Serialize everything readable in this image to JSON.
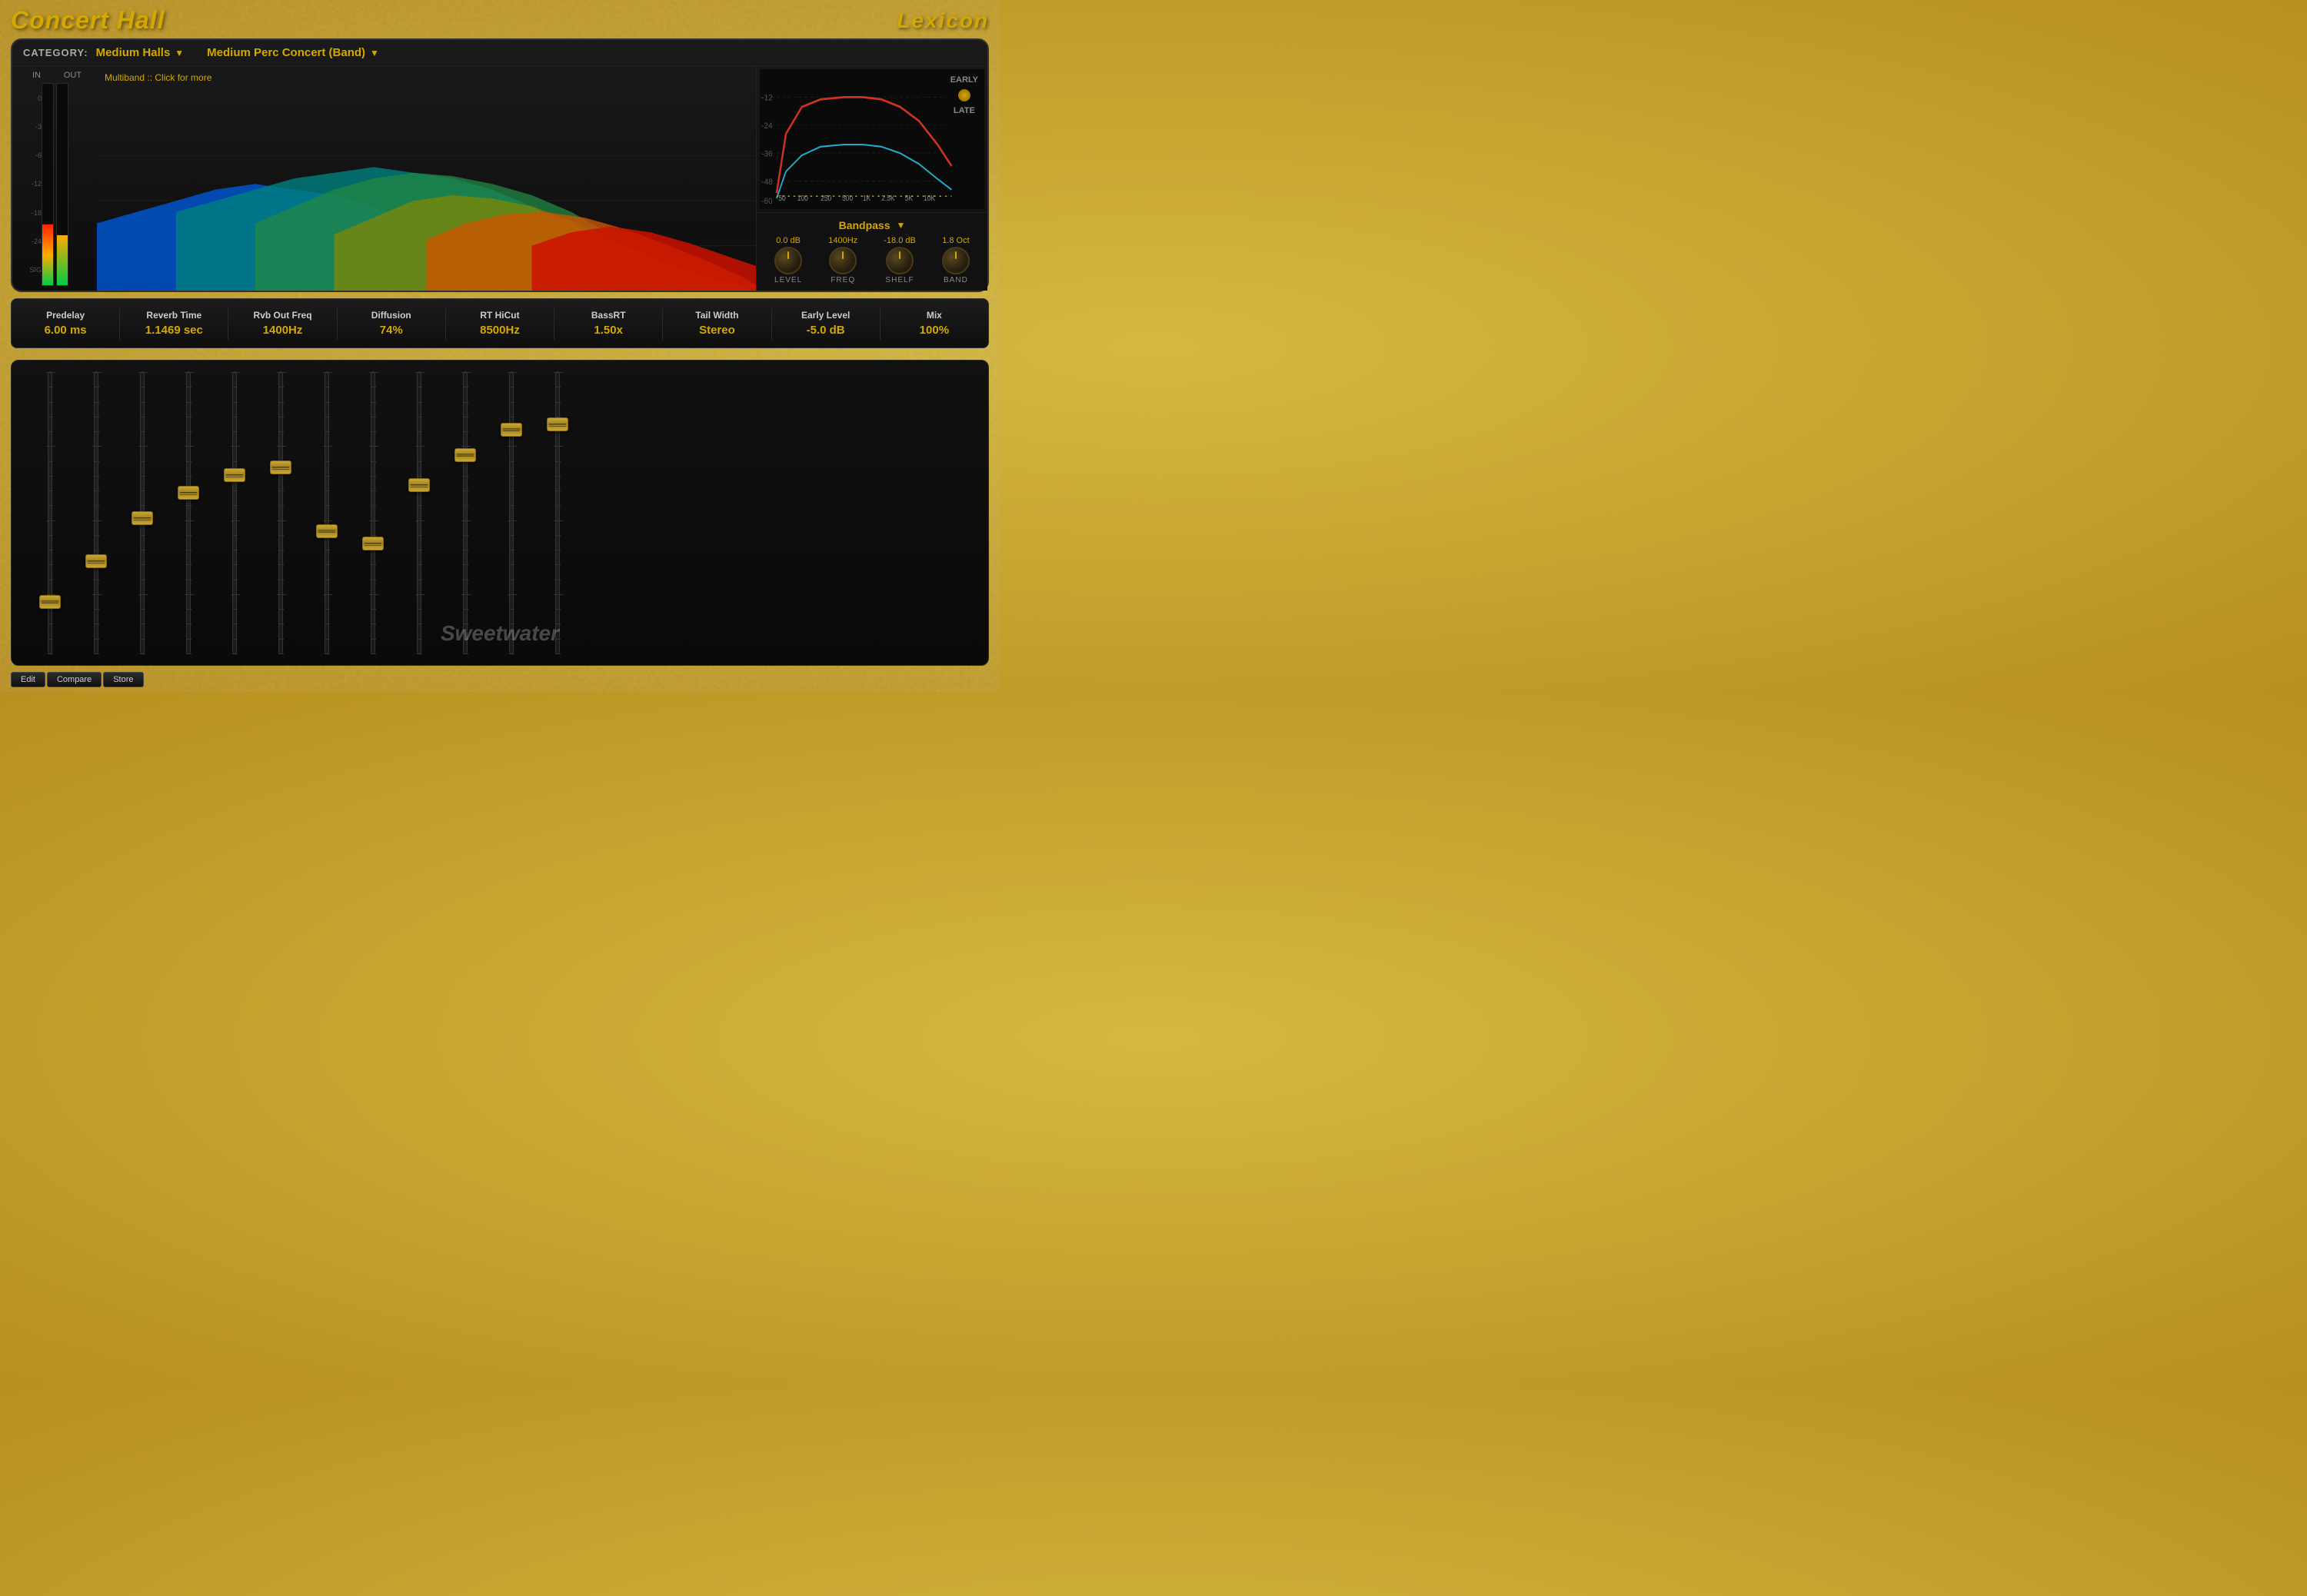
{
  "title": "Concert Hall",
  "brand": "Lexicon",
  "category": {
    "label": "CATEGORY:",
    "value": "Medium Halls",
    "preset": "Medium Perc Concert (Band)"
  },
  "spectrum": {
    "label": "Multiband :: Click for more"
  },
  "vu": {
    "in_label": "IN",
    "out_label": "OUT",
    "ticks": [
      "0",
      "-3",
      "-6",
      "-12",
      "-18",
      "-24",
      "SIG"
    ]
  },
  "eq": {
    "freq_labels": [
      "50",
      "100",
      "250",
      "500",
      "1K",
      "2.5K",
      "5K",
      "10K"
    ],
    "db_labels": [
      "-12",
      "-24",
      "-36",
      "-48",
      "-60"
    ],
    "early_label": "EARLY",
    "late_label": "LATE"
  },
  "bandpass": {
    "title": "Bandpass",
    "knobs": [
      {
        "value": "0.0 dB",
        "label": "LEVEL"
      },
      {
        "value": "1400Hz",
        "label": "FREQ"
      },
      {
        "value": "-18.0 dB",
        "label": "SHELF"
      },
      {
        "value": "1.8 Oct",
        "label": "BAND"
      }
    ]
  },
  "params": [
    {
      "name": "Predelay",
      "value": "6.00 ms"
    },
    {
      "name": "Reverb Time",
      "value": "1.1469 sec"
    },
    {
      "name": "Rvb Out Freq",
      "value": "1400Hz"
    },
    {
      "name": "Diffusion",
      "value": "74%"
    },
    {
      "name": "RT HiCut",
      "value": "8500Hz"
    },
    {
      "name": "BassRT",
      "value": "1.50x"
    },
    {
      "name": "Tail Width",
      "value": "Stereo"
    },
    {
      "name": "Early Level",
      "value": "-5.0 dB"
    },
    {
      "name": "Mix",
      "value": "100%"
    }
  ],
  "faders": {
    "count": 12,
    "positions": [
      0.88,
      0.72,
      0.55,
      0.45,
      0.38,
      0.35,
      0.6,
      0.65,
      0.42,
      0.3,
      0.2,
      0.18
    ]
  },
  "bottom_buttons": [
    "Edit",
    "Compare",
    "Store"
  ],
  "watermark": "Sweetwater"
}
